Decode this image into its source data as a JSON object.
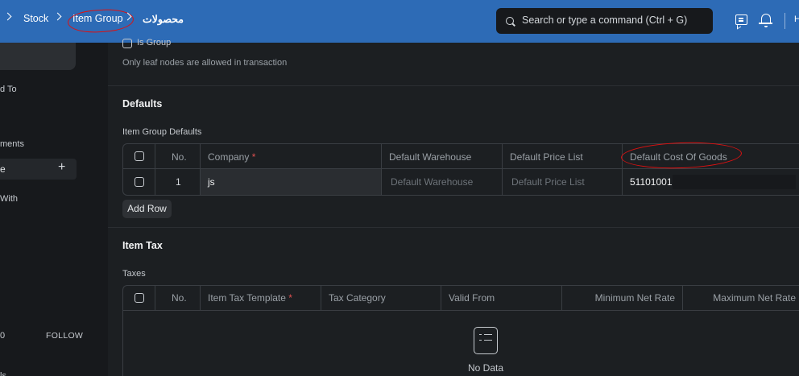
{
  "navbar": {
    "breadcrumbs": [
      "Stock",
      "Item Group",
      "محصولات"
    ],
    "search_placeholder": "Search or type a command (Ctrl + G)",
    "user_initial": "H"
  },
  "sidebar": {
    "frag_assigned": "d To",
    "frag_attachments": "ments",
    "frag_tag": "e",
    "frag_shared": "With",
    "frag_zero": "0",
    "follow": "FOLLOW",
    "frag_bottom": "ls"
  },
  "form": {
    "is_group_label": "Is Group",
    "is_group_hint": "Only leaf nodes are allowed in transaction",
    "defaults_title": "Defaults",
    "defaults_table_label": "Item Group Defaults",
    "defaults_columns": [
      "No.",
      "Company",
      "Default Warehouse",
      "Default Price List",
      "Default Cost Of Goods"
    ],
    "defaults_rows": [
      {
        "no": "1",
        "company": "js",
        "warehouse_placeholder": "Default Warehouse",
        "price_list_placeholder": "Default Price List",
        "cost_of_goods": "51101001"
      }
    ],
    "add_row": "Add Row",
    "item_tax_title": "Item Tax",
    "taxes_label": "Taxes",
    "taxes_columns": [
      "No.",
      "Item Tax Template",
      "Tax Category",
      "Valid From",
      "Minimum Net Rate",
      "Maximum Net Rate"
    ],
    "no_data": "No Data"
  },
  "colors": {
    "navbar": "#2d6bb6",
    "required": "#e05050",
    "annotation": "#dd1111"
  }
}
